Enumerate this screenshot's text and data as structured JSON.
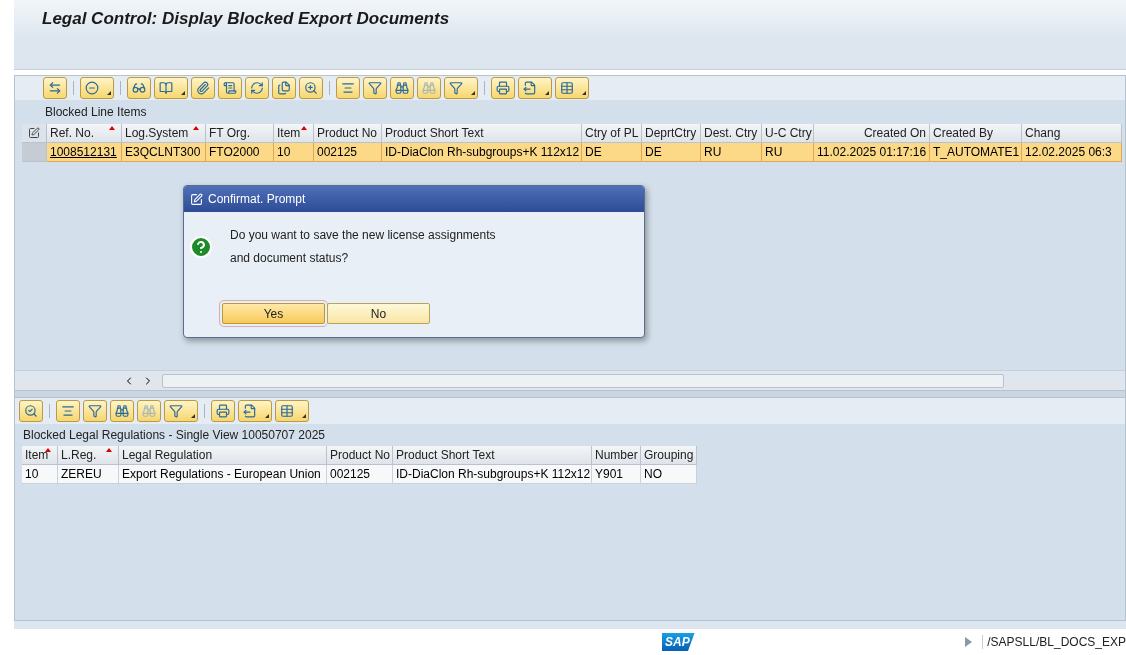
{
  "window": {
    "title": "Legal Control: Display Blocked Export Documents"
  },
  "top_toolbar": [
    {
      "menu": false,
      "disabled": false
    },
    {
      "menu": true,
      "disabled": false
    },
    {
      "menu": false,
      "disabled": false
    },
    {
      "menu": true,
      "disabled": false
    },
    {
      "menu": false,
      "disabled": false
    },
    {
      "menu": false,
      "disabled": false
    },
    {
      "menu": false,
      "disabled": false
    },
    {
      "menu": false,
      "disabled": false
    },
    {
      "menu": false,
      "disabled": false
    },
    {
      "menu": false,
      "disabled": false
    },
    {
      "menu": false,
      "disabled": false
    },
    {
      "menu": false,
      "disabled": false
    },
    {
      "menu": false,
      "disabled": true
    },
    {
      "menu": true,
      "disabled": false
    },
    {
      "menu": false,
      "disabled": false
    },
    {
      "menu": true,
      "disabled": false
    },
    {
      "menu": true,
      "disabled": false
    }
  ],
  "top_table": {
    "title": "Blocked Line Items",
    "columns": [
      {
        "label": "Ref. No.",
        "sorted": true
      },
      {
        "label": "Log.System",
        "sorted": true
      },
      {
        "label": "FT Org.",
        "sorted": false
      },
      {
        "label": "Item",
        "sorted": true
      },
      {
        "label": "Product No",
        "sorted": false
      },
      {
        "label": "Product Short Text",
        "sorted": false
      },
      {
        "label": "Ctry of PL",
        "sorted": false
      },
      {
        "label": "DeprtCtry",
        "sorted": false
      },
      {
        "label": "Dest. Ctry",
        "sorted": false
      },
      {
        "label": "U-C Ctry",
        "sorted": false
      },
      {
        "label": "Created On",
        "sorted": false
      },
      {
        "label": "Created By",
        "sorted": false
      },
      {
        "label": "Chang",
        "sorted": false
      }
    ],
    "rows": [
      {
        "selected": true,
        "cells": [
          "1008512131",
          "E3QCLNT300",
          "FTO2000",
          "10",
          "002125",
          "ID-DiaClon Rh-subgroups+K 112x12",
          "DE",
          "DE",
          "RU",
          "RU",
          "11.02.2025 01:17:16",
          "T_AUTOMATE1",
          "12.02.2025 06:3"
        ]
      }
    ]
  },
  "dialog": {
    "title": "Confirmat. Prompt",
    "lines": [
      "Do you want to save the new license assignments",
      "and document status?"
    ],
    "buttons": [
      {
        "label": "Yes",
        "focused": true
      },
      {
        "label": "No",
        "focused": false
      }
    ]
  },
  "bottom_toolbar": [
    {
      "menu": false,
      "disabled": false
    },
    {
      "menu": false,
      "disabled": false
    },
    {
      "menu": false,
      "disabled": false
    },
    {
      "menu": false,
      "disabled": false
    },
    {
      "menu": false,
      "disabled": true
    },
    {
      "menu": true,
      "disabled": false
    },
    {
      "menu": false,
      "disabled": false
    },
    {
      "menu": true,
      "disabled": false
    },
    {
      "menu": true,
      "disabled": false
    }
  ],
  "bottom_table": {
    "title": "Blocked Legal Regulations - Single View 10050707 2025",
    "columns": [
      {
        "label": "Item",
        "sorted": true
      },
      {
        "label": "L.Reg.",
        "sorted": true
      },
      {
        "label": "Legal Regulation",
        "sorted": false
      },
      {
        "label": "Product No",
        "sorted": false
      },
      {
        "label": "Product Short Text",
        "sorted": false
      },
      {
        "label": "Number",
        "sorted": false
      },
      {
        "label": "Grouping",
        "sorted": false
      }
    ],
    "rows": [
      {
        "selected": false,
        "cells": [
          "10",
          "ZEREU",
          "Export Regulations - European Union",
          "002125",
          "ID-DiaClon Rh-subgroups+K 112x12",
          "Y901",
          "NO"
        ]
      }
    ]
  },
  "status_bar": {
    "logo": "SAP",
    "transaction": "/SAPSLL/BL_DOCS_EXP"
  }
}
